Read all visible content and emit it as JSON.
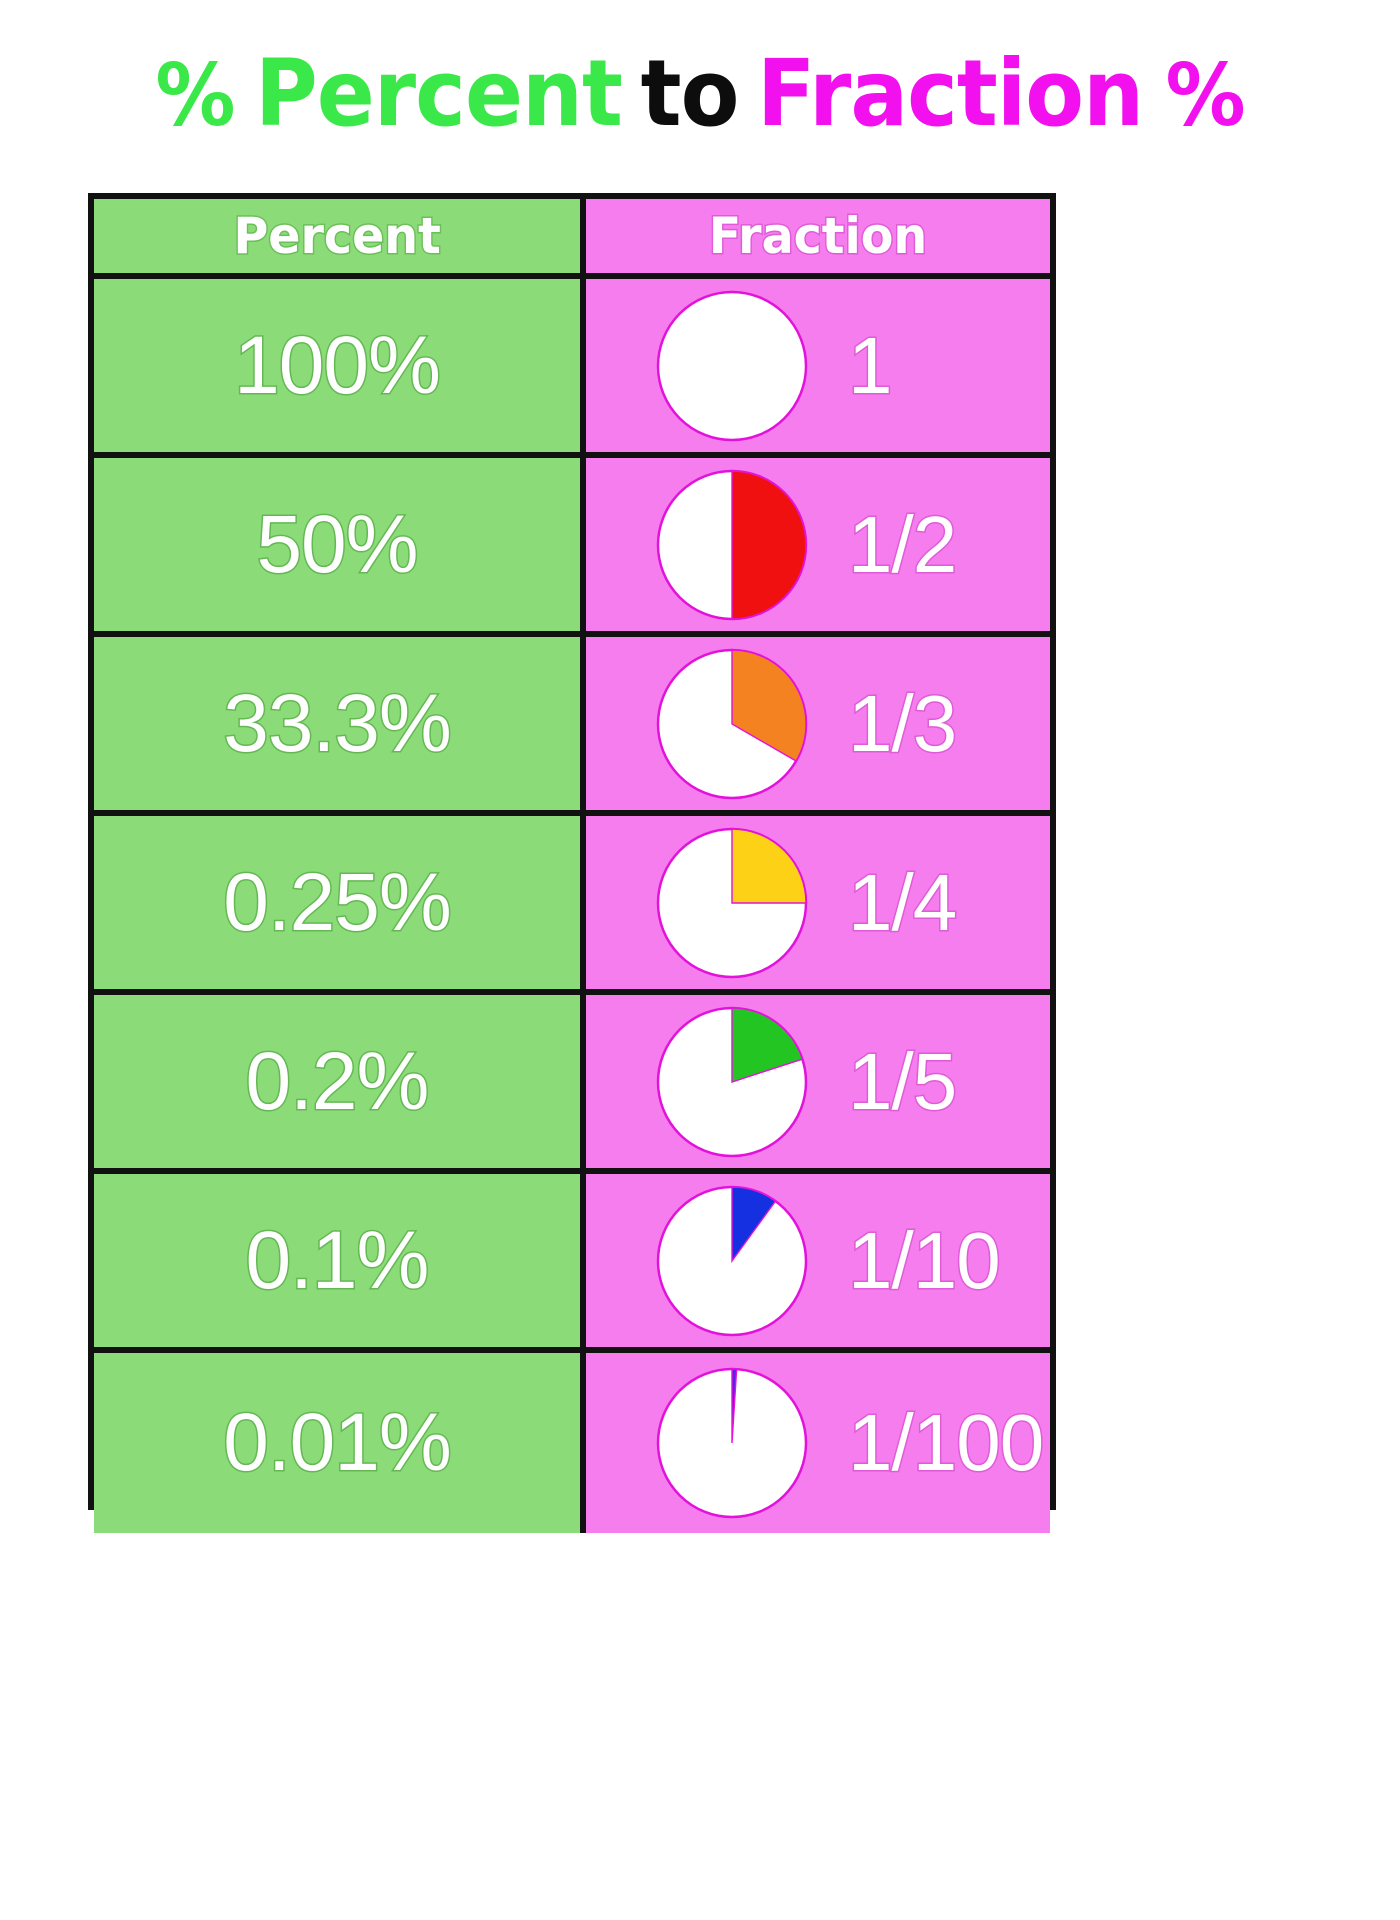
{
  "title": {
    "percent_symbol_left": "%",
    "word_percent": "Percent",
    "word_to": "to",
    "word_fraction": "Fraction",
    "percent_symbol_right": "%"
  },
  "colors": {
    "green_accent": "#3BE84A",
    "magenta_accent": "#F310EE",
    "black": "#0d0d0d",
    "cell_green": "#8BDB78",
    "cell_pink": "#F57DEE",
    "border": "#111111",
    "pie_outline": "#E312DB"
  },
  "table": {
    "headers": {
      "percent": "Percent",
      "fraction": "Fraction"
    },
    "rows": [
      {
        "percent": "100%",
        "fraction": "1",
        "slice_degrees": 360,
        "slice_color": "#ffffff",
        "slice_name": "full-white"
      },
      {
        "percent": "50%",
        "fraction": "1/2",
        "slice_degrees": 180,
        "slice_color": "#F01010",
        "slice_name": "red"
      },
      {
        "percent": "33.3%",
        "fraction": "1/3",
        "slice_degrees": 120,
        "slice_color": "#F58220",
        "slice_name": "orange"
      },
      {
        "percent": "0.25%",
        "fraction": "1/4",
        "slice_degrees": 90,
        "slice_color": "#FCD116",
        "slice_name": "yellow"
      },
      {
        "percent": "0.2%",
        "fraction": "1/5",
        "slice_degrees": 72,
        "slice_color": "#22C522",
        "slice_name": "green"
      },
      {
        "percent": "0.1%",
        "fraction": "1/10",
        "slice_degrees": 36,
        "slice_color": "#1530E0",
        "slice_name": "blue"
      },
      {
        "percent": "0.01%",
        "fraction": "1/100",
        "slice_degrees": 3.6,
        "slice_color": "#5522E8",
        "slice_name": "violet"
      }
    ]
  },
  "chart_data": {
    "type": "pie",
    "title": "Percent to Fraction",
    "description": "Seven pie charts each showing a shaded fraction of a circle paired with its percent value.",
    "categories": [
      "1",
      "1/2",
      "1/3",
      "1/4",
      "1/5",
      "1/10",
      "1/100"
    ],
    "percent_labels": [
      "100%",
      "50%",
      "33.3%",
      "0.25%",
      "0.2%",
      "0.1%",
      "0.01%"
    ],
    "values": [
      1,
      0.5,
      0.3333,
      0.25,
      0.2,
      0.1,
      0.01
    ],
    "slice_degrees": [
      360,
      180,
      120,
      90,
      72,
      36,
      3.6
    ],
    "slice_colors": [
      "#ffffff",
      "#F01010",
      "#F58220",
      "#FCD116",
      "#22C522",
      "#1530E0",
      "#5522E8"
    ],
    "unfilled_color": "#ffffff",
    "start_angle_deg": 0,
    "direction": "clockwise",
    "legend": "none",
    "grid": false
  }
}
